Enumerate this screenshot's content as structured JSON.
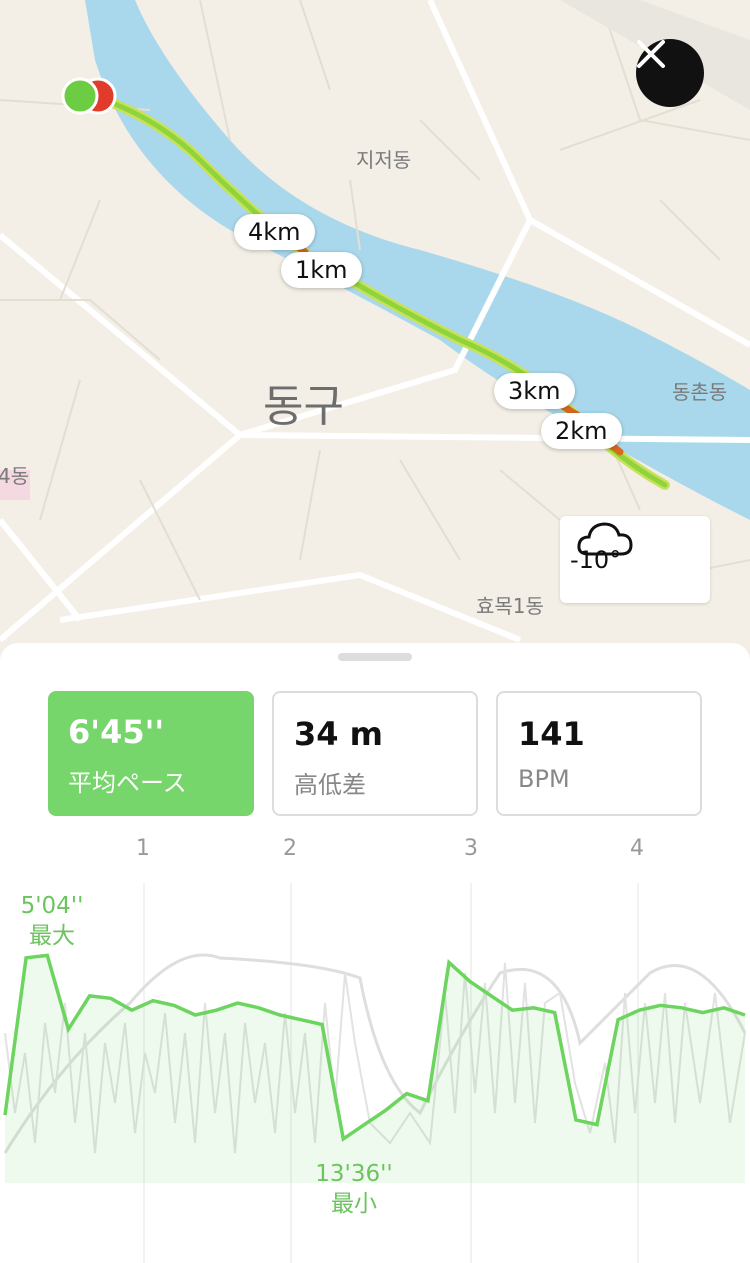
{
  "map": {
    "districts": {
      "jijeo": "지저동",
      "donggu": "동구",
      "dongchon": "동촌동",
      "hyomok": "효목1동",
      "left_partial": "4동"
    },
    "km_markers": [
      "1km",
      "2km",
      "3km",
      "4km"
    ],
    "close_icon": "close-icon",
    "weather": {
      "temperature": "-10°",
      "icon": "cloud-icon"
    }
  },
  "stats": {
    "pace": {
      "value": "6'45''",
      "label": "平均ペース"
    },
    "elevation": {
      "value": "34 m",
      "label": "高低差"
    },
    "heart_rate": {
      "value": "141",
      "label": "BPM"
    }
  },
  "colors": {
    "accent": "#76d66b",
    "route_line": "#9ad63a",
    "route_slow": "#e0701e",
    "river": "#a9d8ec"
  },
  "chart_data": {
    "type": "line",
    "x_ticks": [
      "1",
      "2",
      "3",
      "4"
    ],
    "max_annotation": {
      "value": "5'04''",
      "label": "最大"
    },
    "min_annotation": {
      "value": "13'36''",
      "label": "最小"
    },
    "series": [
      {
        "values": [
          11.8,
          5.2,
          5.1,
          8.2,
          6.8,
          6.9,
          7.4,
          7.0,
          7.2,
          7.6,
          7.4,
          7.1,
          7.3,
          7.6,
          7.8,
          8.0,
          12.8,
          12.2,
          11.6,
          10.9,
          11.2,
          5.4,
          6.2,
          6.8,
          7.4,
          7.3,
          7.5,
          12.0,
          12.2,
          7.8,
          7.4,
          7.2,
          7.3,
          7.5,
          7.3,
          7.6
        ]
      }
    ]
  }
}
